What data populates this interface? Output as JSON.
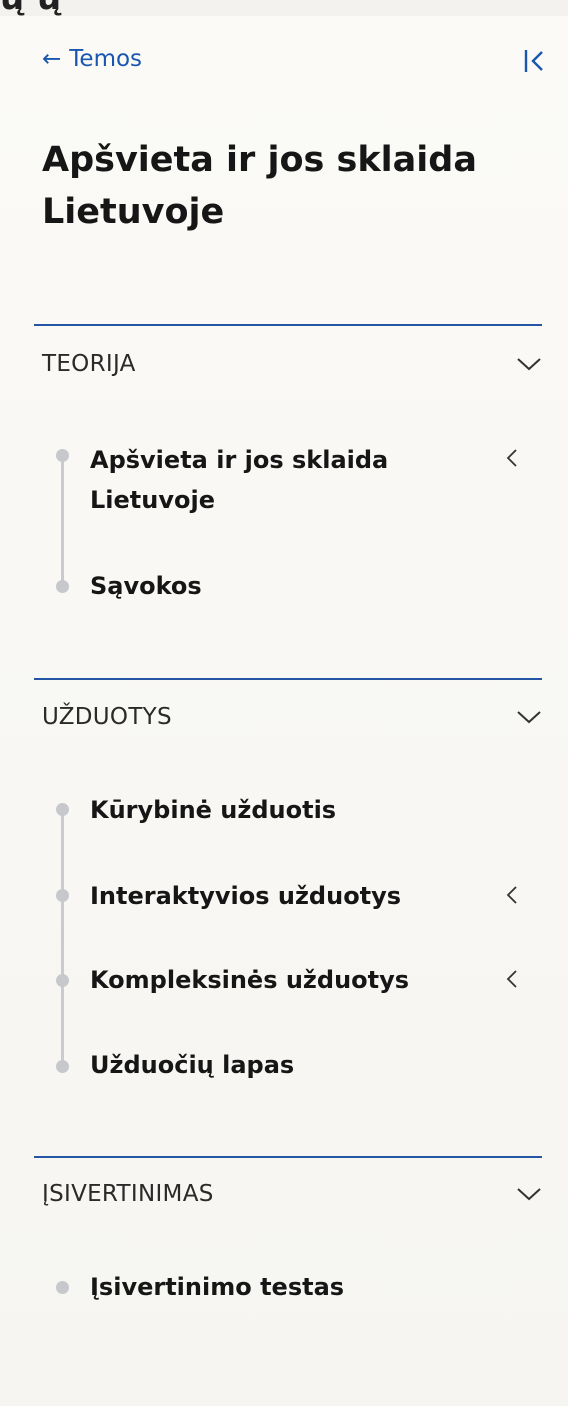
{
  "top_strip_text": "ų ų",
  "nav": {
    "back_label": "Temos",
    "back_arrow": "←",
    "collapse_icon": "collapse-left-icon"
  },
  "page_title": "Apšvieta ir jos sklaida Lietuvoje",
  "colors": {
    "accent": "#1a56b0",
    "rule": "#2456a4",
    "dot": "#c6c8cc"
  },
  "sections": [
    {
      "title": "TEORIJA",
      "expanded": true,
      "items": [
        {
          "label": "Apšvieta ir jos sklaida Lietuvoje",
          "has_submenu": true
        },
        {
          "label": "Sąvokos",
          "has_submenu": false
        }
      ]
    },
    {
      "title": "UŽDUOTYS",
      "expanded": true,
      "items": [
        {
          "label": "Kūrybinė užduotis",
          "has_submenu": false
        },
        {
          "label": "Interaktyvios užduotys",
          "has_submenu": true
        },
        {
          "label": "Kompleksinės užduotys",
          "has_submenu": true
        },
        {
          "label": "Užduočių lapas",
          "has_submenu": false
        }
      ]
    },
    {
      "title": "ĮSIVERTINIMAS",
      "expanded": true,
      "items": [
        {
          "label": "Įsivertinimo testas",
          "has_submenu": false
        }
      ]
    }
  ]
}
